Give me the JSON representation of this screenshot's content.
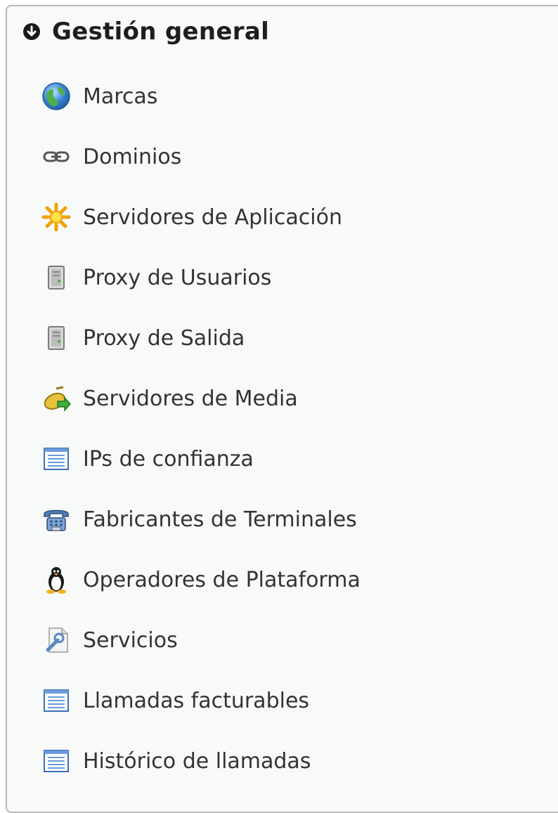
{
  "panel": {
    "title": "Gestión general",
    "collapse_icon": "collapse-circle-icon"
  },
  "menu": {
    "items": [
      {
        "label": "Marcas",
        "icon": "globe-icon"
      },
      {
        "label": "Dominios",
        "icon": "link-icon"
      },
      {
        "label": "Servidores de Aplicación",
        "icon": "sun-icon"
      },
      {
        "label": "Proxy de Usuarios",
        "icon": "server-icon"
      },
      {
        "label": "Proxy de Salida",
        "icon": "server-icon"
      },
      {
        "label": "Servidores de Media",
        "icon": "media-server-icon"
      },
      {
        "label": "IPs de confianza",
        "icon": "list-icon"
      },
      {
        "label": "Fabricantes de Terminales",
        "icon": "telephone-icon"
      },
      {
        "label": "Operadores de Plataforma",
        "icon": "penguin-icon"
      },
      {
        "label": "Servicios",
        "icon": "wrench-icon"
      },
      {
        "label": "Llamadas facturables",
        "icon": "list-icon"
      },
      {
        "label": "Histórico de llamadas",
        "icon": "list-icon"
      }
    ]
  }
}
